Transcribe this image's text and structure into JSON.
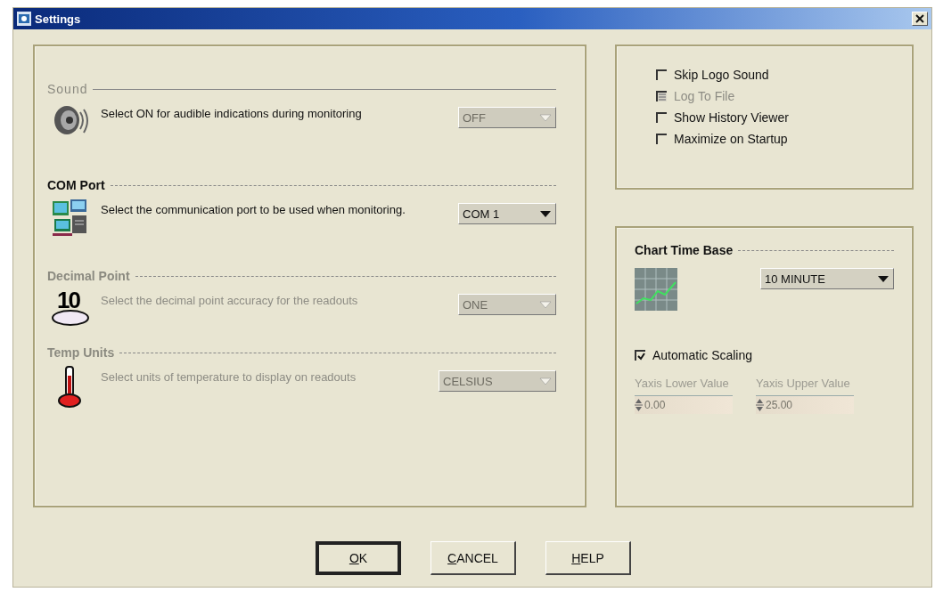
{
  "window": {
    "title": "Settings"
  },
  "sections": [
    {
      "title": "Sound",
      "disabled": true,
      "description": "Select ON for audible indications during monitoring",
      "description_disabled": false,
      "kind": "speaker",
      "value": "OFF"
    },
    {
      "title": "COM Port",
      "disabled": false,
      "description": "Select the communication port to be used when monitoring.",
      "description_disabled": false,
      "kind": "network",
      "value": "COM 1"
    },
    {
      "title": "Decimal Point",
      "disabled": true,
      "description": "Select the  decimal point accuracy for the readouts",
      "description_disabled": true,
      "kind": "decimal",
      "icon_text": "10",
      "value": "ONE"
    },
    {
      "title": "Temp Units",
      "disabled": true,
      "description": "Select units of temperature to display on readouts",
      "description_disabled": true,
      "kind": "thermometer",
      "value": "CELSIUS"
    }
  ],
  "options": [
    {
      "label": "Skip Logo Sound",
      "checked": false,
      "disabled": false
    },
    {
      "label": "Log To File",
      "checked": true,
      "disabled": true
    },
    {
      "label": "Show  History Viewer",
      "checked": false,
      "disabled": false
    },
    {
      "label": "Maximize on Startup",
      "checked": false,
      "disabled": false
    }
  ],
  "chart_time_base": {
    "title": "Chart Time Base",
    "value": "10 MINUTE",
    "auto_scaling": {
      "label": "Automatic Scaling",
      "checked": true
    },
    "fields": [
      {
        "label": "Yaxis Lower Value",
        "value": "0.00",
        "disabled": true
      },
      {
        "label": "Yaxis Upper Value",
        "value": "25.00",
        "disabled": true
      }
    ]
  },
  "buttons": [
    {
      "label": "OK",
      "default": true
    },
    {
      "label": "CANCEL",
      "default": false
    },
    {
      "label": "HELP",
      "default": false
    }
  ]
}
